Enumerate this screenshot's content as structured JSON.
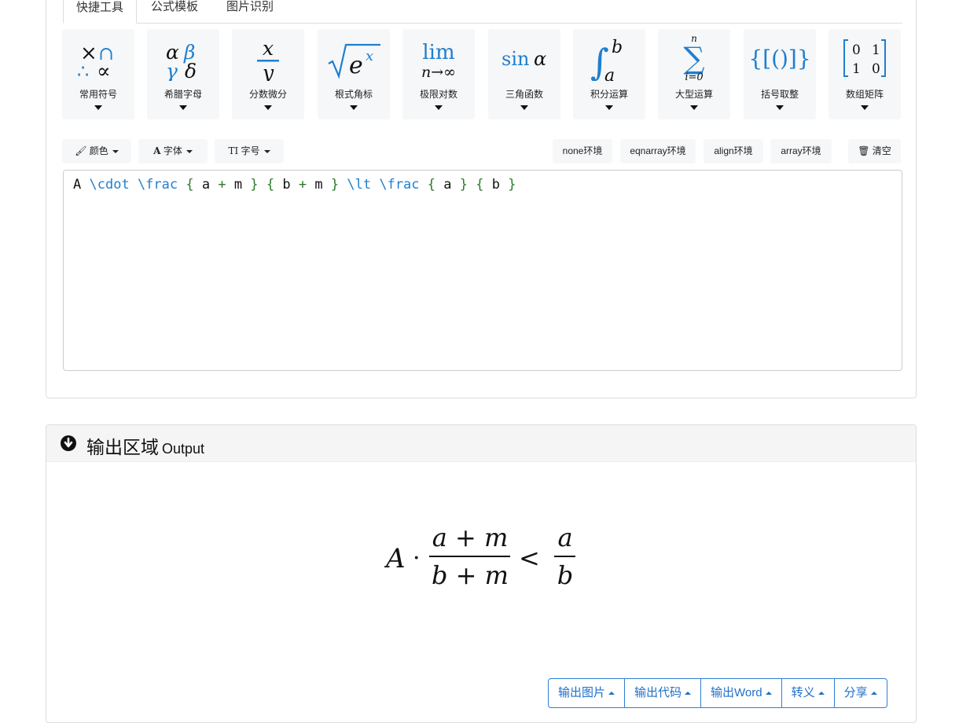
{
  "tabs": [
    {
      "label": "快捷工具",
      "active": true
    },
    {
      "label": "公式模板",
      "active": false
    },
    {
      "label": "图片识别",
      "active": false
    }
  ],
  "tools": [
    {
      "label": "常用符号",
      "icon": "common-symbols-icon"
    },
    {
      "label": "希腊字母",
      "icon": "greek-letters-icon"
    },
    {
      "label": "分数微分",
      "icon": "fraction-icon"
    },
    {
      "label": "根式角标",
      "icon": "radical-icon"
    },
    {
      "label": "极限对数",
      "icon": "limit-icon"
    },
    {
      "label": "三角函数",
      "icon": "trig-icon"
    },
    {
      "label": "积分运算",
      "icon": "integral-icon"
    },
    {
      "label": "大型运算",
      "icon": "summation-icon"
    },
    {
      "label": "括号取整",
      "icon": "brackets-icon"
    },
    {
      "label": "数组矩阵",
      "icon": "matrix-icon"
    }
  ],
  "format_buttons": {
    "color": "颜色",
    "font": "字体",
    "size": "字号"
  },
  "env_buttons": {
    "none": "none环境",
    "eqnarray": "eqnarray环境",
    "align": "align环境",
    "array": "array环境",
    "clear": "清空"
  },
  "editor": {
    "tokens": [
      {
        "t": "A",
        "c": "tx"
      },
      {
        "t": " "
      },
      {
        "t": "\\cdot",
        "c": "cmd"
      },
      {
        "t": " "
      },
      {
        "t": "\\frac",
        "c": "cmd"
      },
      {
        "t": " "
      },
      {
        "t": "{",
        "c": "br"
      },
      {
        "t": " "
      },
      {
        "t": "a",
        "c": "tx"
      },
      {
        "t": " "
      },
      {
        "t": "+",
        "c": "op"
      },
      {
        "t": " "
      },
      {
        "t": "m",
        "c": "tx"
      },
      {
        "t": " "
      },
      {
        "t": "}",
        "c": "br"
      },
      {
        "t": " "
      },
      {
        "t": "{",
        "c": "br"
      },
      {
        "t": " "
      },
      {
        "t": "b",
        "c": "tx"
      },
      {
        "t": " "
      },
      {
        "t": "+",
        "c": "op"
      },
      {
        "t": " "
      },
      {
        "t": "m",
        "c": "tx"
      },
      {
        "t": " "
      },
      {
        "t": "}",
        "c": "br"
      },
      {
        "t": " "
      },
      {
        "t": "\\lt",
        "c": "cmd"
      },
      {
        "t": " "
      },
      {
        "t": "\\frac",
        "c": "cmd"
      },
      {
        "t": " "
      },
      {
        "t": "{",
        "c": "br"
      },
      {
        "t": " "
      },
      {
        "t": "a",
        "c": "tx"
      },
      {
        "t": " "
      },
      {
        "t": "}",
        "c": "br"
      },
      {
        "t": " "
      },
      {
        "t": "{",
        "c": "br"
      },
      {
        "t": " "
      },
      {
        "t": "b",
        "c": "tx"
      },
      {
        "t": " "
      },
      {
        "t": "}",
        "c": "br"
      }
    ]
  },
  "output": {
    "title": "输出区域",
    "subtitle": "Output",
    "formula": {
      "lhs": "A",
      "dot": "·",
      "num1": "a + m",
      "den1": "b + m",
      "rel": "<",
      "num2": "a",
      "den2": "b"
    },
    "buttons": [
      "输出图片",
      "输出代码",
      "输出Word",
      "转义",
      "分享"
    ]
  },
  "colors": {
    "accent": "#2f7fd6",
    "cmd": "#1f7fd0",
    "brace": "#2b7a2b"
  }
}
